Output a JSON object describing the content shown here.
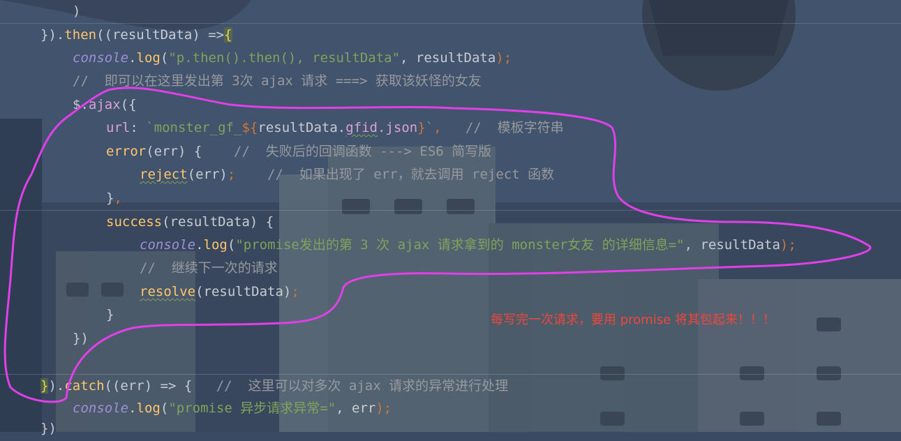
{
  "code": {
    "line_1": {
      "close_paren": ")"
    },
    "line_2": {
      "p1": "}).",
      "then": "then",
      "p2": "((resultData) =>",
      "brace": "{"
    },
    "line_3": {
      "console": "console",
      "dot": ".",
      "log": "log",
      "p1": "(",
      "str": "\"p.then().then(), resultData\"",
      "p2": ", resultData",
      "semi": ");"
    },
    "line_4": {
      "comment": "//  即可以在这里发出第 3次 ajax 请求 ===> 获取该妖怪的女友"
    },
    "line_5": {
      "dollar": "$",
      "dot": ".",
      "ajax": "ajax",
      "rest": "({"
    },
    "line_6": {
      "key": "url",
      "colon": ": ",
      "str_a": "`monster_gf_",
      "interp_open": "${",
      "expr_a": "resultData.",
      "expr_gfid": "gfid",
      "expr_b": ".json",
      "interp_close": "}",
      "str_b": "`",
      "comma": ",",
      "comment": "   //  模板字符串"
    },
    "line_7": {
      "fn": "error",
      "rest": "(err) {",
      "comment": "    //  失败后的回调函数 ---> ES6 简写版"
    },
    "line_8": {
      "fn": "reject",
      "rest": "(err)",
      "semi": ";",
      "comment": "    //  如果出现了 err，就去调用 reject 函数"
    },
    "line_9": {
      "brace": "}",
      "comma": ","
    },
    "line_10": {
      "fn": "success",
      "rest": "(resultData) {"
    },
    "line_11": {
      "console": "console",
      "dot": ".",
      "log": "log",
      "p1": "(",
      "str": "\"promise发出的第 3 次 ajax 请求拿到的 monster女友 的详细信息=\"",
      "p2": ", resultData",
      "semi": ");"
    },
    "line_12": {
      "comment": "//  继续下一次的请求"
    },
    "line_13": {
      "fn": "resolve",
      "rest": "(resultData)",
      "semi": ";"
    },
    "line_14": {
      "brace": "}"
    },
    "line_15": {
      "text": "})"
    },
    "line_17": {
      "bracket": "}",
      "p1": ").",
      "catch": "catch",
      "p2": "((err) => {",
      "comment": "   //  这里可以对多次 ajax 请求的异常进行处理"
    },
    "line_18": {
      "console": "console",
      "dot": ".",
      "log": "log",
      "p1": "(",
      "str": "\"promise 异步请求异常=\"",
      "p2": ", err",
      "semi": ");"
    },
    "line_19": {
      "text": "})"
    }
  },
  "annotation": {
    "note": "每写完一次请求，要用 promise 将其包起来！！！",
    "color": "#f0463c",
    "stroke_color": "#e040e8"
  }
}
